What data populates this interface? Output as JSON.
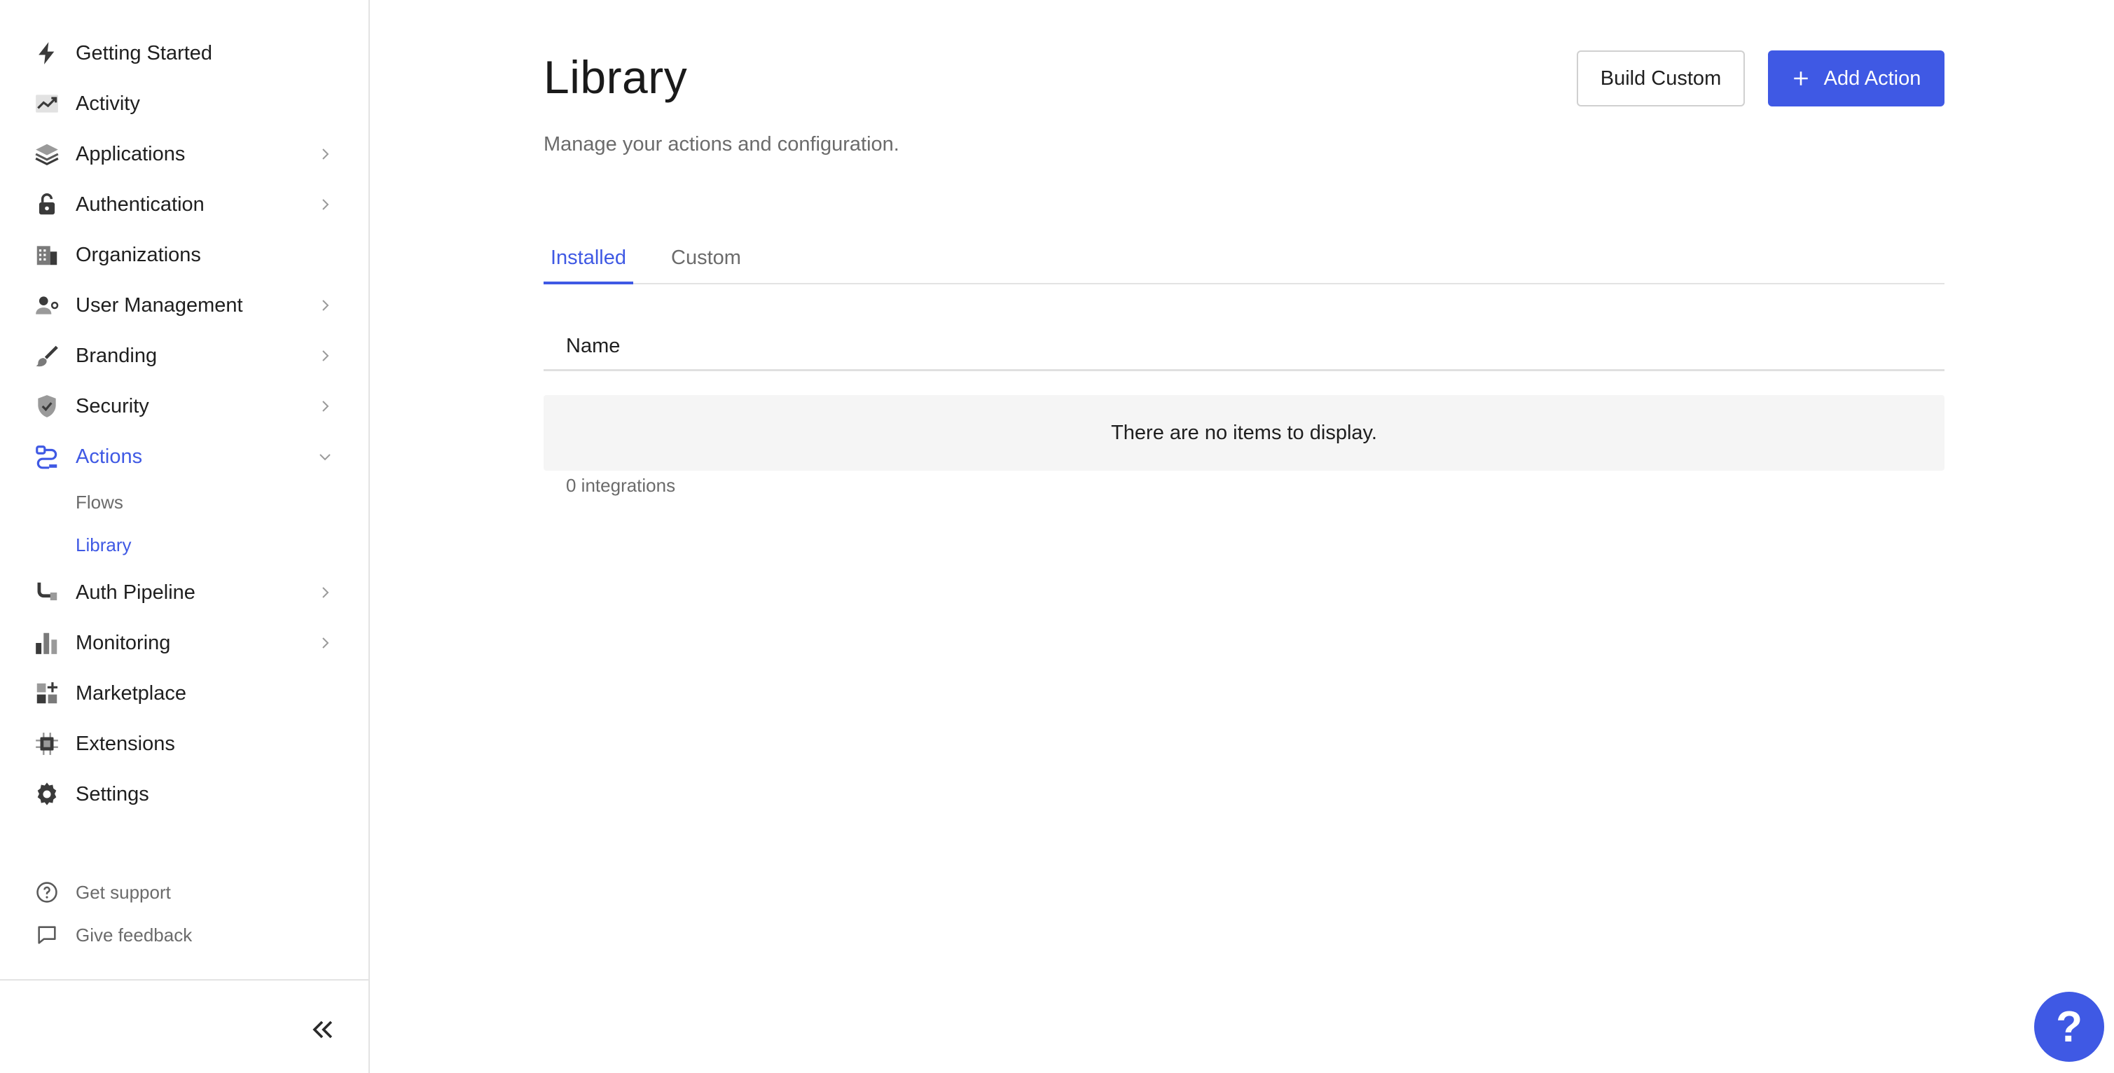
{
  "sidebar": {
    "items": [
      {
        "label": "Getting Started",
        "icon": "lightning-icon"
      },
      {
        "label": "Activity",
        "icon": "activity-chart-icon"
      },
      {
        "label": "Applications",
        "icon": "layers-icon"
      },
      {
        "label": "Authentication",
        "icon": "lock-icon"
      },
      {
        "label": "Organizations",
        "icon": "building-icon"
      },
      {
        "label": "User Management",
        "icon": "user-icon"
      },
      {
        "label": "Branding",
        "icon": "brush-icon"
      },
      {
        "label": "Security",
        "icon": "shield-icon"
      },
      {
        "label": "Actions",
        "icon": "actions-flow-icon"
      },
      {
        "label": "Auth Pipeline",
        "icon": "pipeline-icon"
      },
      {
        "label": "Monitoring",
        "icon": "bar-chart-icon"
      },
      {
        "label": "Marketplace",
        "icon": "grid-plus-icon"
      },
      {
        "label": "Extensions",
        "icon": "chip-icon"
      },
      {
        "label": "Settings",
        "icon": "gear-icon"
      }
    ],
    "actions_sub": [
      {
        "label": "Flows"
      },
      {
        "label": "Library"
      }
    ],
    "footer": [
      {
        "label": "Get support",
        "icon": "question-circle-icon"
      },
      {
        "label": "Give feedback",
        "icon": "chat-bubble-icon"
      }
    ]
  },
  "main": {
    "title": "Library",
    "subtitle": "Manage your actions and configuration.",
    "build_custom_label": "Build Custom",
    "add_action_label": "Add Action",
    "tabs": [
      {
        "label": "Installed",
        "active": true
      },
      {
        "label": "Custom",
        "active": false
      }
    ],
    "table": {
      "columns": [
        "Name"
      ],
      "empty_message": "There are no items to display."
    },
    "count_text": "0 integrations"
  },
  "help_fab": {
    "label": "?"
  },
  "colors": {
    "accent": "#3f59e4",
    "text": "#1f1f1f",
    "muted": "#6b6b6b",
    "border": "#e3e3e3"
  }
}
